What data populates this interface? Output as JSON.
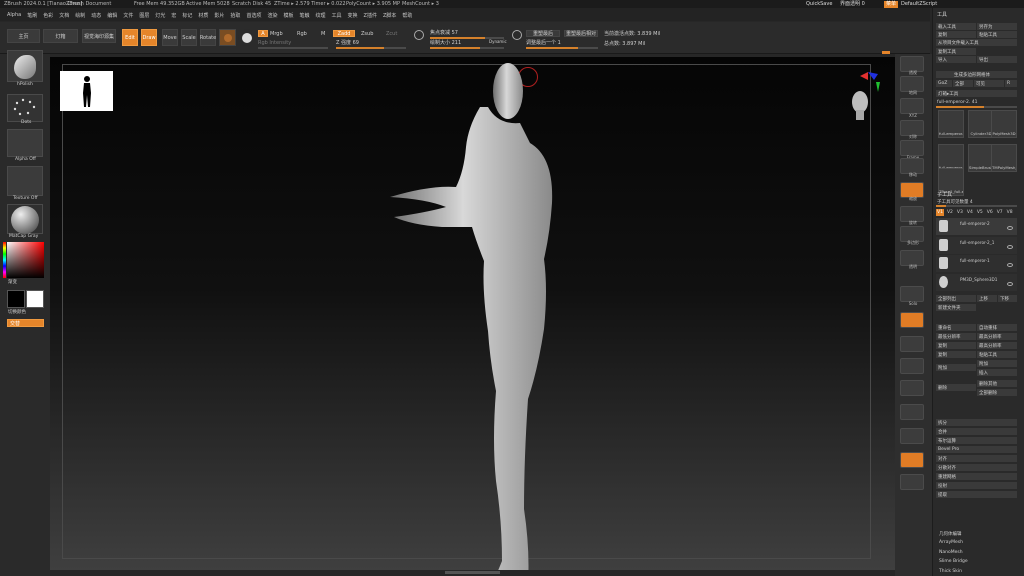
{
  "titlebar": {
    "app": "ZBrush 2024.0.1 [Tianao Chen]",
    "doc": "ZBrush Document",
    "free_mem": "Free Mem 49.352GB",
    "active_mem": "Active Mem 5028",
    "scratch": "Scratch Disk 45",
    "ztime": "ZTime ▸ 2.579 Timer ▸ 0.022",
    "polycount": "PolyCount ▸ 3.905 MP",
    "meshcount": "MeshCount ▸ 3",
    "quicksave": "QuickSave",
    "transparency": "界面透明 0",
    "menu_btn": "菜单",
    "script": "DefaultZScript"
  },
  "menu": [
    "Alpha",
    "笔刷",
    "色彩",
    "文档",
    "绘制",
    "动态",
    "编辑",
    "文件",
    "图层",
    "灯光",
    "宏",
    "标记",
    "材质",
    "影片",
    "拾取",
    "首选项",
    "渲染",
    "模板",
    "笔触",
    "纹理",
    "工具",
    "变换",
    "Z插件",
    "Z脚本",
    "帮助"
  ],
  "topbar": {
    "lightbox": "主页",
    "lightbox2": "灯箱",
    "btn_light": "视觉海印源集",
    "edit": "Edit",
    "draw": "Draw",
    "move": "Move",
    "scale": "Scale",
    "rotate": "Rotate",
    "a": "A",
    "mrgb": "Mrgb",
    "rgb": "Rgb",
    "m": "M",
    "zadd": "Zadd",
    "zsub": "Zsub",
    "zcut": "Zcut",
    "rgb_int": "Rgb Intensity",
    "z_int": "Z 强度 69",
    "focal": "焦点衰减 57",
    "draw_size": "绘制大小 211",
    "dynamic": "Dynamic",
    "persp": "重塑最后",
    "persp2": "重塑最后相对",
    "adjust": "调整最后一个 1",
    "active_pts": "当前激活点数: 3.839 Mil",
    "total_pts": "总点数: 3.897 Mil"
  },
  "left": {
    "brush": "hPolish",
    "stroke": "Dots",
    "alpha": "Alpha Off",
    "texture": "Texture Off",
    "material": "MatCap Gray",
    "gradient": "渐变",
    "switch": "切换颜色",
    "alternate": "交替"
  },
  "right_shelf": [
    "透视",
    "地网",
    "XYZ",
    "对称",
    "Frame",
    "移动",
    "缩放",
    "旋转",
    "多边形",
    "透明",
    "Solo"
  ],
  "palette": {
    "title": "工具",
    "load": "载入工具",
    "save_as": "另存为",
    "copy": "复制",
    "paste": "粘贴工具",
    "import": "从项目文件载入工具",
    "clone": "复制工具",
    "make_poly": "生成多边形网格体",
    "import2": "导入",
    "export": "导出",
    "goz": "GoZ",
    "all": "全部",
    "visible": "可见",
    "r": "R",
    "lightbox_tools": "灯箱▸工具",
    "current": "full-emperor-2. 41",
    "tools": [
      "full-emperor-2",
      "Cylinder3D",
      "PolyMesh3D",
      "full-emperor-2",
      "SimpleBrush",
      "TMPolyMesh_1",
      "TPose1_full-emperor"
    ],
    "subtool_header": "子工具",
    "visible_count": "子工具可见数量 4",
    "v_tabs": [
      "V1",
      "V2",
      "V3",
      "V4",
      "V5",
      "V6",
      "V7",
      "V8"
    ],
    "subtools": [
      "full-emperor-2",
      "full-emperor-2_1",
      "full-emperor-1",
      "PM3D_Sphere3D1"
    ],
    "list_all": "全部列出",
    "up": "上移",
    "down": "下移",
    "new_folder": "新建文件夹",
    "rename": "重命名",
    "auto_reorder": "自动重排",
    "all_low": "最低分辨率",
    "all_high": "最高分辨率",
    "dup": "复制",
    "insert": "插入",
    "append": "附加",
    "delete": "删除",
    "del_other": "删除其他",
    "del_all": "全部删除",
    "split": "拆分",
    "merge": "合并",
    "boolean": "布尔运算",
    "bevel": "Bevel Pro",
    "align": "对齐",
    "distribute": "分散对齐",
    "remesh": "重建网格",
    "project": "投射",
    "extract": "提取",
    "geometry": "几何体编辑",
    "items": [
      "ArrayMesh",
      "NanoMesh",
      "Slime Bridge",
      "Thick Skin"
    ]
  },
  "colors": {
    "accent": "#e5852a",
    "swatch_black": "#000000",
    "swatch_white": "#ffffff"
  }
}
